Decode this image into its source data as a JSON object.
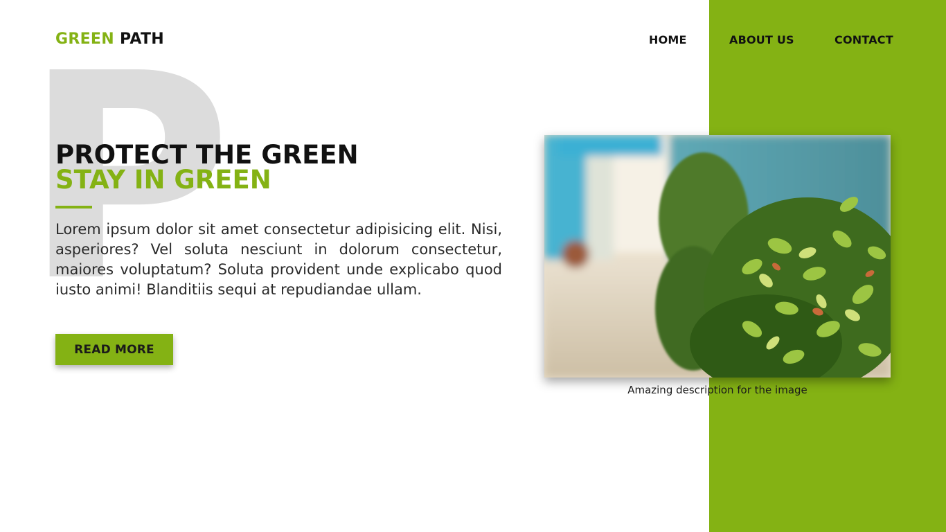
{
  "brand": {
    "part1": "GREEN",
    "part2": "PATH",
    "accent_color": "#84b214"
  },
  "nav": {
    "home": "HOME",
    "about": "ABOUT US",
    "contact": "CONTACT"
  },
  "hero": {
    "background_letter": "P",
    "title_line1": "PROTECT THE GREEN",
    "title_line2": "STAY IN GREEN",
    "body": "Lorem ipsum dolor sit amet consectetur adipisicing elit. Nisi, asperiores? Vel soluta nesciunt in dolorum consectetur, maiores voluptatum? Soluta provident unde explicabo quod iusto animi! Blanditiis sequi at repudiandae ullam.",
    "button_label": "READ MORE"
  },
  "figure": {
    "caption": "Amazing description for the image"
  }
}
